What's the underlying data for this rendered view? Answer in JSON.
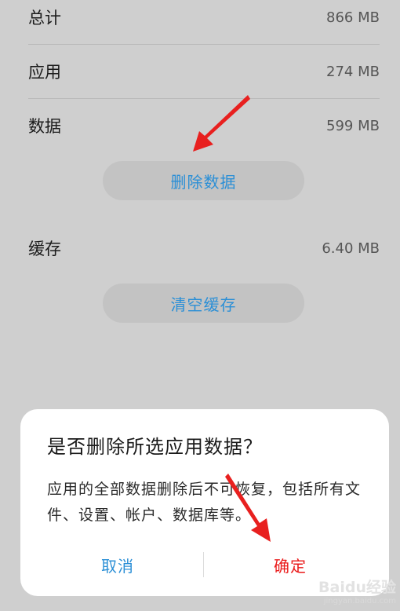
{
  "storage": {
    "rows": [
      {
        "label": "总计",
        "value": "866 MB"
      },
      {
        "label": "应用",
        "value": "274 MB"
      },
      {
        "label": "数据",
        "value": "599 MB"
      },
      {
        "label": "缓存",
        "value": "6.40 MB"
      }
    ],
    "delete_data_button": "删除数据",
    "clear_cache_button": "清空缓存"
  },
  "dialog": {
    "title": "是否删除所选应用数据？",
    "message": "应用的全部数据删除后不可恢复，包括所有文件、设置、帐户、数据库等。",
    "cancel_label": "取消",
    "confirm_label": "确定"
  },
  "watermark": {
    "logo_text": "Baidu经验",
    "url_text": "jingyan.baidu.com"
  },
  "colors": {
    "accent_blue": "#2b8fd6",
    "confirm_red": "#ea1a1a",
    "annotation_arrow": "#e8201f",
    "overlay_background": "#cfcfcf"
  },
  "icons": [
    "annotation-arrow-icon"
  ]
}
